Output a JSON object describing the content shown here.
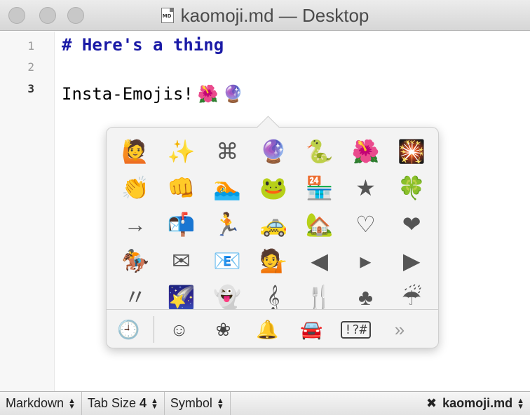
{
  "window": {
    "title": "kaomoji.md — Desktop",
    "file_icon_label": "MD"
  },
  "editor": {
    "line_numbers": [
      "1",
      "2",
      "3"
    ],
    "current_line": "3",
    "lines": {
      "heading": "# Here's a thing",
      "line3_text": "Insta-Emojis!",
      "line3_emoji_1": "🌺",
      "line3_emoji_2": "🔮"
    }
  },
  "emoji_picker": {
    "rows": [
      [
        "🙋",
        "✨",
        "⌘",
        "🔮",
        "🐍",
        "🌺",
        "🎇"
      ],
      [
        "👏",
        "👊",
        "🏊",
        "🐸",
        "🏪",
        "★",
        "🍀"
      ],
      [
        "→",
        "📬",
        "🏃",
        "🚕",
        "🏡",
        "♡",
        "❤"
      ],
      [
        "🏇",
        "✉",
        "📧",
        "💁",
        "◀",
        "▸",
        "▶"
      ],
      [
        "〃",
        "🌠",
        "👻",
        "𝄞",
        "🍴",
        "♣",
        "☔"
      ]
    ],
    "categories": [
      {
        "name": "recent-icon",
        "glyph": "🕘"
      },
      {
        "name": "smiley-icon",
        "glyph": "☺"
      },
      {
        "name": "flower-icon",
        "glyph": "❀"
      },
      {
        "name": "bell-icon",
        "glyph": "🔔"
      },
      {
        "name": "car-icon",
        "glyph": "🚘"
      },
      {
        "name": "symbols-icon",
        "glyph": "!?#"
      },
      {
        "name": "more-icon",
        "glyph": "»"
      }
    ]
  },
  "statusbar": {
    "syntax": "Markdown",
    "tab_size_label": "Tab Size",
    "tab_size_value": "4",
    "symbol": "Symbol",
    "close_glyph": "✖",
    "filename": "kaomoji.md",
    "arrow_up": "▲",
    "arrow_down": "▼"
  },
  "colors": {
    "heading": "#1a1aa6",
    "active_category": "#2a7dd9"
  }
}
